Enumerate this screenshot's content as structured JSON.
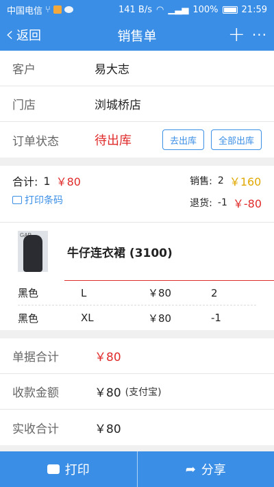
{
  "statusbar": {
    "carrier": "中国电信",
    "speed": "141 B/s",
    "battery": "100%",
    "time": "21:59"
  },
  "nav": {
    "back_label": "返回",
    "title": "销售单",
    "plus": "+",
    "more": "···"
  },
  "order": {
    "customer_label": "客户",
    "customer": "易大志",
    "store_label": "门店",
    "store": "浏城桥店",
    "status_label": "订单状态",
    "status": "待出库",
    "btn_ship": "去出库",
    "btn_ship_all": "全部出库"
  },
  "summary": {
    "total_label": "合计:",
    "total_qty": "1",
    "total_amount": "￥80",
    "print_barcode": "打印条码",
    "sales_label": "销售:",
    "sales_qty": "2",
    "sales_amount": "￥160",
    "returns_label": "退货:",
    "returns_qty": "-1",
    "returns_amount": "￥-80"
  },
  "product": {
    "name": "牛仔连衣裙 (3100)",
    "thumb_logo": "GAP",
    "skus": [
      {
        "color": "黑色",
        "size": "L",
        "price": "￥80",
        "qty": "2"
      },
      {
        "color": "黑色",
        "size": "XL",
        "price": "￥80",
        "qty": "-1"
      }
    ]
  },
  "totals": {
    "doc_total_label": "单据合计",
    "doc_total": "￥80",
    "received_label": "收款金额",
    "received": "￥80",
    "received_method": "(支付宝)",
    "actual_label": "实收合计",
    "actual": "￥80"
  },
  "footer": {
    "print_label": "打印",
    "share_label": "分享"
  },
  "colors": {
    "primary": "#3a8ee6",
    "red": "#e02b2b",
    "gold": "#e0a800"
  }
}
